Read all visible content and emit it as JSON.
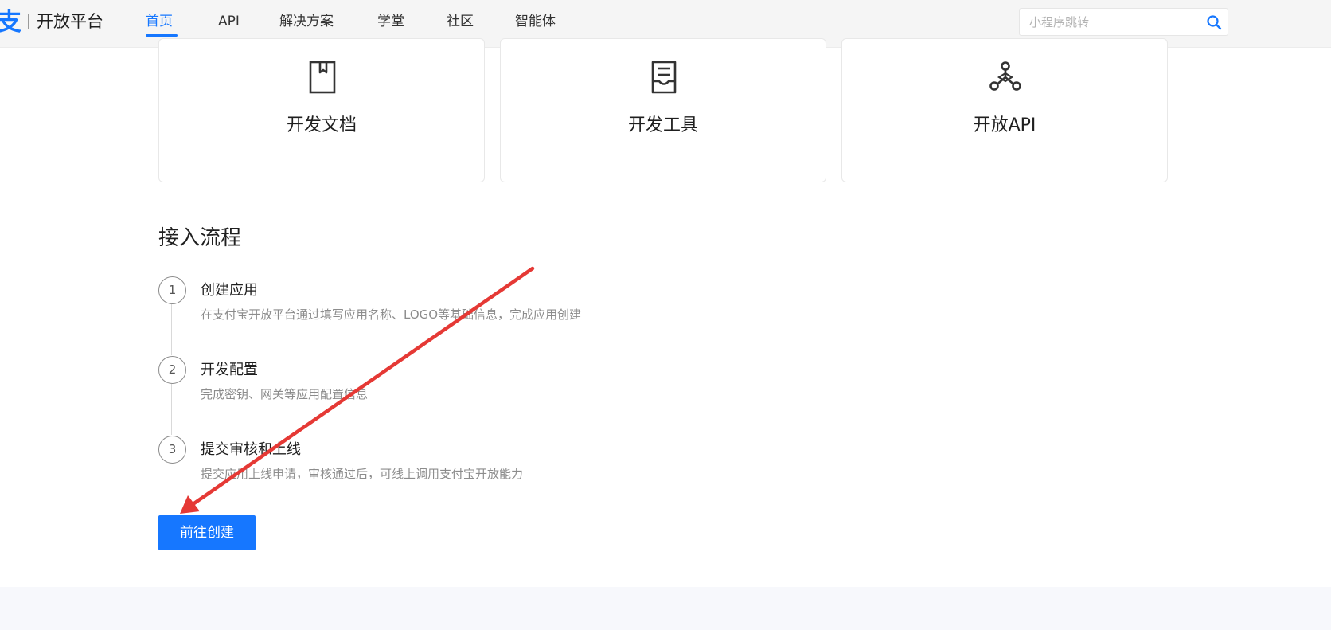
{
  "header": {
    "logo_mark": "支",
    "logo_text": "开放平台",
    "nav": [
      {
        "label": "首页",
        "active": true
      },
      {
        "label": "API",
        "active": false
      },
      {
        "label": "解决方案",
        "active": false
      },
      {
        "label": "学堂",
        "active": false
      },
      {
        "label": "社区",
        "active": false
      },
      {
        "label": "智能体",
        "active": false
      }
    ],
    "search": {
      "placeholder": "小程序跳转",
      "value": "",
      "icon": "search-icon"
    }
  },
  "cards": [
    {
      "label": "开发文档",
      "icon": "document-icon"
    },
    {
      "label": "开发工具",
      "icon": "tool-icon"
    },
    {
      "label": "开放API",
      "icon": "api-icon"
    }
  ],
  "process": {
    "title": "接入流程",
    "steps": [
      {
        "number": "1",
        "title": "创建应用",
        "desc": "在支付宝开放平台通过填写应用名称、LOGO等基础信息，完成应用创建"
      },
      {
        "number": "2",
        "title": "开发配置",
        "desc": "完成密钥、网关等应用配置信息"
      },
      {
        "number": "3",
        "title": "提交审核和上线",
        "desc": "提交应用上线申请，审核通过后，可线上调用支付宝开放能力"
      }
    ],
    "button_label": "前往创建"
  },
  "colors": {
    "accent": "#1677ff",
    "annotation": "#e53935"
  }
}
